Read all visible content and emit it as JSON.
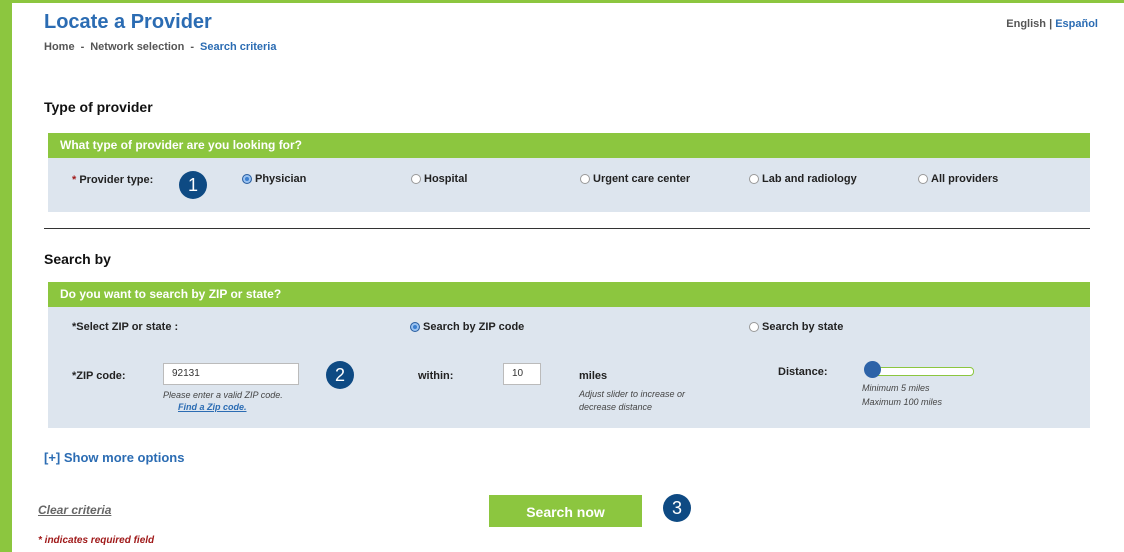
{
  "header": {
    "title": "Locate a Provider",
    "breadcrumb": [
      "Home",
      "-",
      "Network selection",
      "-",
      "Search criteria"
    ],
    "lang": {
      "english": "English",
      "sep": "|",
      "spanish": "Español"
    }
  },
  "provider_section": {
    "title": "Type of provider",
    "question": "What type of provider are you looking for?",
    "field_label": "Provider type:",
    "required_mark": "*",
    "options": [
      "Physician",
      "Hospital",
      "Urgent care center",
      "Lab and radiology",
      "All providers"
    ],
    "selected": "Physician"
  },
  "search_section": {
    "title": "Search by",
    "question": "Do you want to search by ZIP or state?",
    "select_label": "*Select ZIP or state :",
    "options": [
      "Search by ZIP code",
      "Search by state"
    ],
    "selected": "Search by ZIP code",
    "zip_label": "*ZIP code:",
    "zip_value": "92131",
    "zip_hint": "Please enter a valid ZIP code.",
    "find_zip": "Find a Zip code.",
    "within_label": "within:",
    "within_value": "10",
    "miles_label": "miles",
    "slider_hint_1": "Adjust slider to increase or",
    "slider_hint_2": "decrease distance",
    "distance_label": "Distance:",
    "distance_min": "Minimum 5 miles",
    "distance_max": "Maximum 100 miles",
    "distance_level": 0
  },
  "actions": {
    "show_more": "[+] Show more options",
    "clear": "Clear criteria",
    "search": "Search now",
    "required_note": "* indicates required field"
  },
  "steps": [
    "1",
    "2",
    "3"
  ],
  "colors": {
    "accent_green": "#8cc63f",
    "link_blue": "#2b6cb3",
    "panel_bg": "#dde5ee",
    "badge_navy": "#0e4a83"
  }
}
